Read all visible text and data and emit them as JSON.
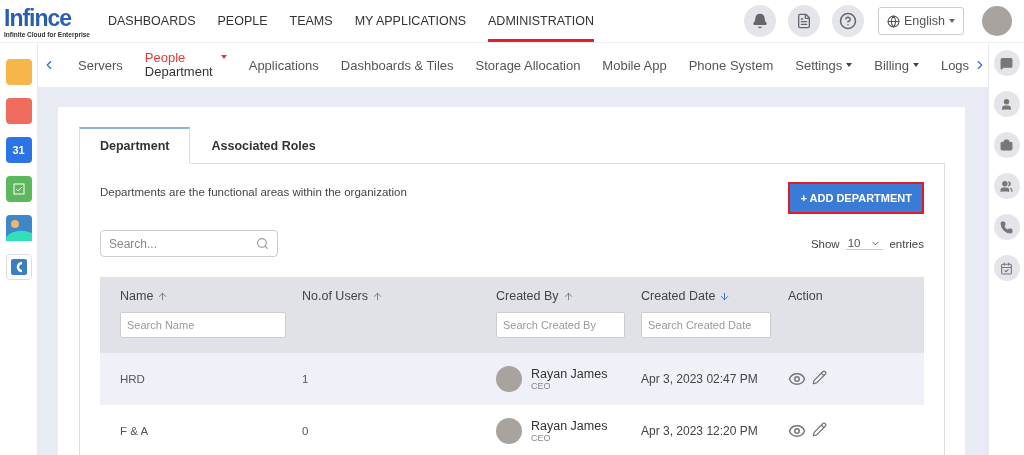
{
  "logo": {
    "name": "Infince",
    "tagline": "Infinite Cloud for Enterprise"
  },
  "top_nav": [
    {
      "label": "DASHBOARDS",
      "selected": false
    },
    {
      "label": "PEOPLE",
      "selected": false
    },
    {
      "label": "TEAMS",
      "selected": false
    },
    {
      "label": "MY APPLICATIONS",
      "selected": false
    },
    {
      "label": "ADMINISTRATION",
      "selected": true
    }
  ],
  "language": "English",
  "left_apps": [
    {
      "kind": "folder"
    },
    {
      "kind": "mail"
    },
    {
      "kind": "calendar",
      "label": "31"
    },
    {
      "kind": "task"
    },
    {
      "kind": "image"
    },
    {
      "kind": "docs"
    }
  ],
  "sub_nav": [
    {
      "label": "Servers",
      "selected": false,
      "dropdown": false
    },
    {
      "label": "Department",
      "group": "People",
      "selected": true,
      "dropdown": true
    },
    {
      "label": "Applications",
      "selected": false,
      "dropdown": false
    },
    {
      "label": "Dashboards & Tiles",
      "selected": false,
      "dropdown": false
    },
    {
      "label": "Storage Allocation",
      "selected": false,
      "dropdown": false
    },
    {
      "label": "Mobile App",
      "selected": false,
      "dropdown": false
    },
    {
      "label": "Phone System",
      "selected": false,
      "dropdown": false
    },
    {
      "label": "Settings",
      "selected": false,
      "dropdown": true
    },
    {
      "label": "Billing",
      "selected": false,
      "dropdown": true
    },
    {
      "label": "Logs",
      "selected": false,
      "dropdown": false
    }
  ],
  "right_tools": [
    {
      "kind": "chat"
    },
    {
      "kind": "user"
    },
    {
      "kind": "user-briefcase"
    },
    {
      "kind": "users"
    },
    {
      "kind": "phone"
    },
    {
      "kind": "calendar-check"
    }
  ],
  "tabs": [
    {
      "label": "Department",
      "selected": true
    },
    {
      "label": "Associated Roles",
      "selected": false
    }
  ],
  "description": "Departments are the functional areas within the organization",
  "add_button": "+ ADD DEPARTMENT",
  "search": {
    "placeholder": "Search..."
  },
  "page_size": {
    "prefix": "Show",
    "value": "10",
    "suffix": "entries"
  },
  "table": {
    "columns": [
      {
        "label": "Name",
        "sortable": true,
        "sorted": false,
        "filter_placeholder": "Search Name"
      },
      {
        "label": "No.of Users",
        "sortable": true,
        "sorted": false
      },
      {
        "label": "Created By",
        "sortable": true,
        "sorted": false,
        "filter_placeholder": "Search Created By"
      },
      {
        "label": "Created Date",
        "sortable": true,
        "sorted": true,
        "filter_placeholder": "Search Created Date"
      },
      {
        "label": "Action",
        "sortable": false
      }
    ],
    "rows": [
      {
        "name": "HRD",
        "users": "1",
        "creator": "Rayan James",
        "role": "CEO",
        "date": "Apr 3, 2023 02:47 PM",
        "highlighted": true
      },
      {
        "name": "F & A",
        "users": "0",
        "creator": "Rayan James",
        "role": "CEO",
        "date": "Apr 3, 2023 12:20 PM",
        "highlighted": false
      }
    ]
  }
}
